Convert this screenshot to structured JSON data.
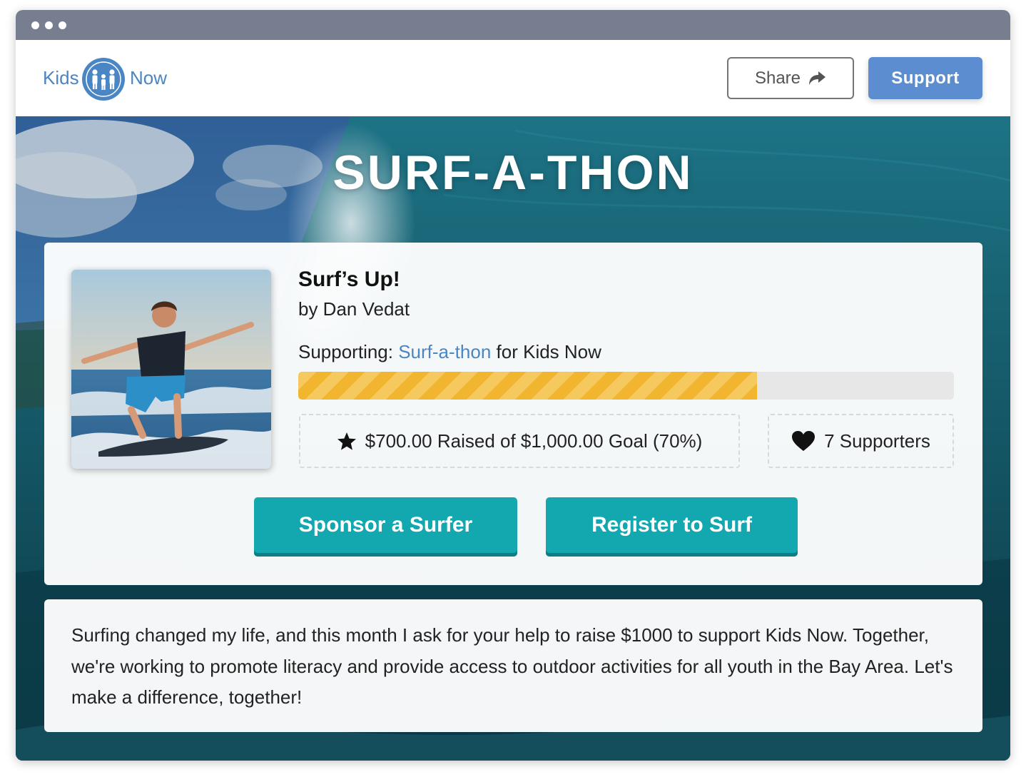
{
  "brand": {
    "logo_left": "Kids",
    "logo_right": "Now",
    "logo_icon": "family-icon",
    "color": "#4a86c3"
  },
  "header": {
    "share_label": "Share",
    "share_icon": "share-arrow-icon",
    "support_label": "Support"
  },
  "hero": {
    "title": "SURF-A-THON"
  },
  "campaign": {
    "title": "Surf’s Up!",
    "byline": "by Dan Vedat",
    "supporting_prefix": "Supporting:",
    "supporting_link": "Surf-a-thon",
    "supporting_suffix": "for Kids Now",
    "progress_fraction": 0.7,
    "raised_text": "$700.00 Raised of $1,000.00 Goal (70%)",
    "raised_icon": "star-icon",
    "supporters_text": "7 Supporters",
    "supporters_icon": "heart-icon",
    "photo": "boy-surfing-photo"
  },
  "actions": {
    "sponsor_label": "Sponsor a Surfer",
    "register_label": "Register to Surf",
    "accent": "#13a7b0"
  },
  "description": {
    "text": "Surfing changed my life, and this month I ask for your help to raise $1000 to support Kids Now. Together, we're working to promote literacy and provide access to outdoor activities for all youth in the Bay Area. Let's make a difference, together!"
  },
  "colors": {
    "progress_fill": "#f2b530",
    "support_button": "#5b8dd0",
    "titlebar": "#767e90"
  }
}
